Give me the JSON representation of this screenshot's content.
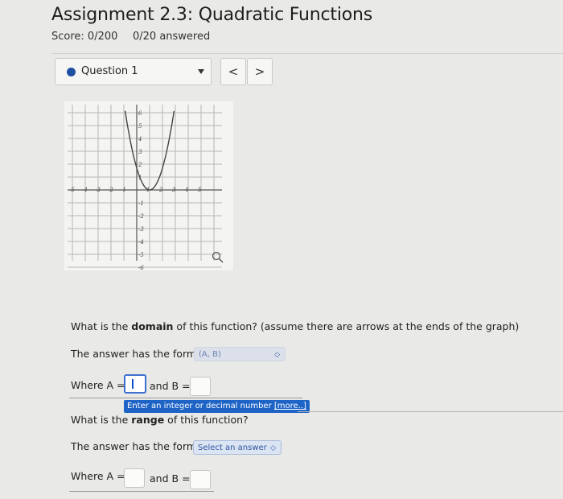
{
  "header": {
    "title": "Assignment 2.3: Quadratic Functions",
    "score": "Score: 0/200",
    "answered": "0/20 answered"
  },
  "question_nav": {
    "selected": "Question 1",
    "prev_glyph": "<",
    "next_glyph": ">",
    "accent": "#1f4fa3"
  },
  "graph": {
    "x_ticks": [
      "-5",
      "-4",
      "-3",
      "-2",
      "-1",
      "1",
      "2",
      "3",
      "4",
      "5"
    ],
    "y_ticks_pos": [
      "6",
      "5",
      "4",
      "3",
      "2",
      "1"
    ],
    "y_ticks_neg": [
      "-1",
      "-2",
      "-3",
      "-4",
      "-5",
      "-6"
    ],
    "zoom_icon": "magnifier-icon"
  },
  "q1": {
    "prefix": "What is the ",
    "bold": "domain",
    "suffix": " of this function? (assume there are arrows at the ends of the graph)",
    "form_prefix": "The answer has the form",
    "form_value": "(A, B)",
    "where_a": "Where A =",
    "and_b": "and B =",
    "tooltip": "Enter an integer or decimal number",
    "tooltip_more": "[more..]"
  },
  "q2": {
    "prefix": "What is the ",
    "bold": "range",
    "suffix": " of this function?",
    "form_prefix": "The answer has the form",
    "form_value": "Select an answer",
    "where_a": "Where A =",
    "and_b": "and B ="
  }
}
